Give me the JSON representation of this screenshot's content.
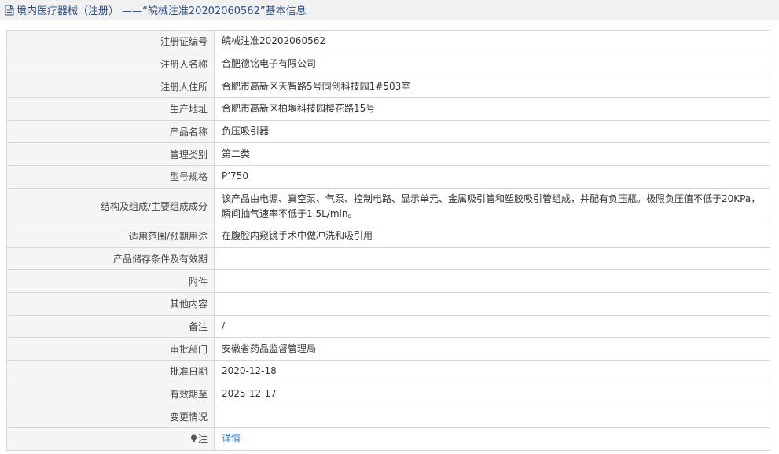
{
  "header": {
    "title": "境内医疗器械（注册） ——“皖械注准20202060562”基本信息"
  },
  "rows": [
    {
      "label": "注册证编号",
      "value": "皖械注准20202060562"
    },
    {
      "label": "注册人名称",
      "value": "合肥德铭电子有限公司"
    },
    {
      "label": "注册人住所",
      "value": "合肥市高新区天智路5号同创科技园1#503室"
    },
    {
      "label": "生产地址",
      "value": "合肥市高新区柏堰科技园樱花路15号"
    },
    {
      "label": "产品名称",
      "value": "负压吸引器"
    },
    {
      "label": "管理类别",
      "value": "第二类"
    },
    {
      "label": "型号规格",
      "value": "P’750"
    },
    {
      "label": "结构及组成/主要组成成分",
      "value": "该产品由电源、真空泵、气泵、控制电路、显示单元、金属吸引管和塑胶吸引管组成，并配有负压瓶。极限负压值不低于20KPa，瞬间抽气速率不低于1.5L/min。"
    },
    {
      "label": "适用范围/预期用途",
      "value": "在腹腔内窥镜手术中做冲洗和吸引用"
    },
    {
      "label": "产品储存条件及有效期",
      "value": ""
    },
    {
      "label": "附件",
      "value": ""
    },
    {
      "label": "其他内容",
      "value": ""
    },
    {
      "label": "备注",
      "value": "/"
    },
    {
      "label": "审批部门",
      "value": "安徽省药品监督管理局"
    },
    {
      "label": "批准日期",
      "value": "2020-12-18"
    },
    {
      "label": "有效期至",
      "value": "2025-12-17"
    },
    {
      "label": "变更情况",
      "value": ""
    },
    {
      "label": "注",
      "value": "详情"
    }
  ]
}
